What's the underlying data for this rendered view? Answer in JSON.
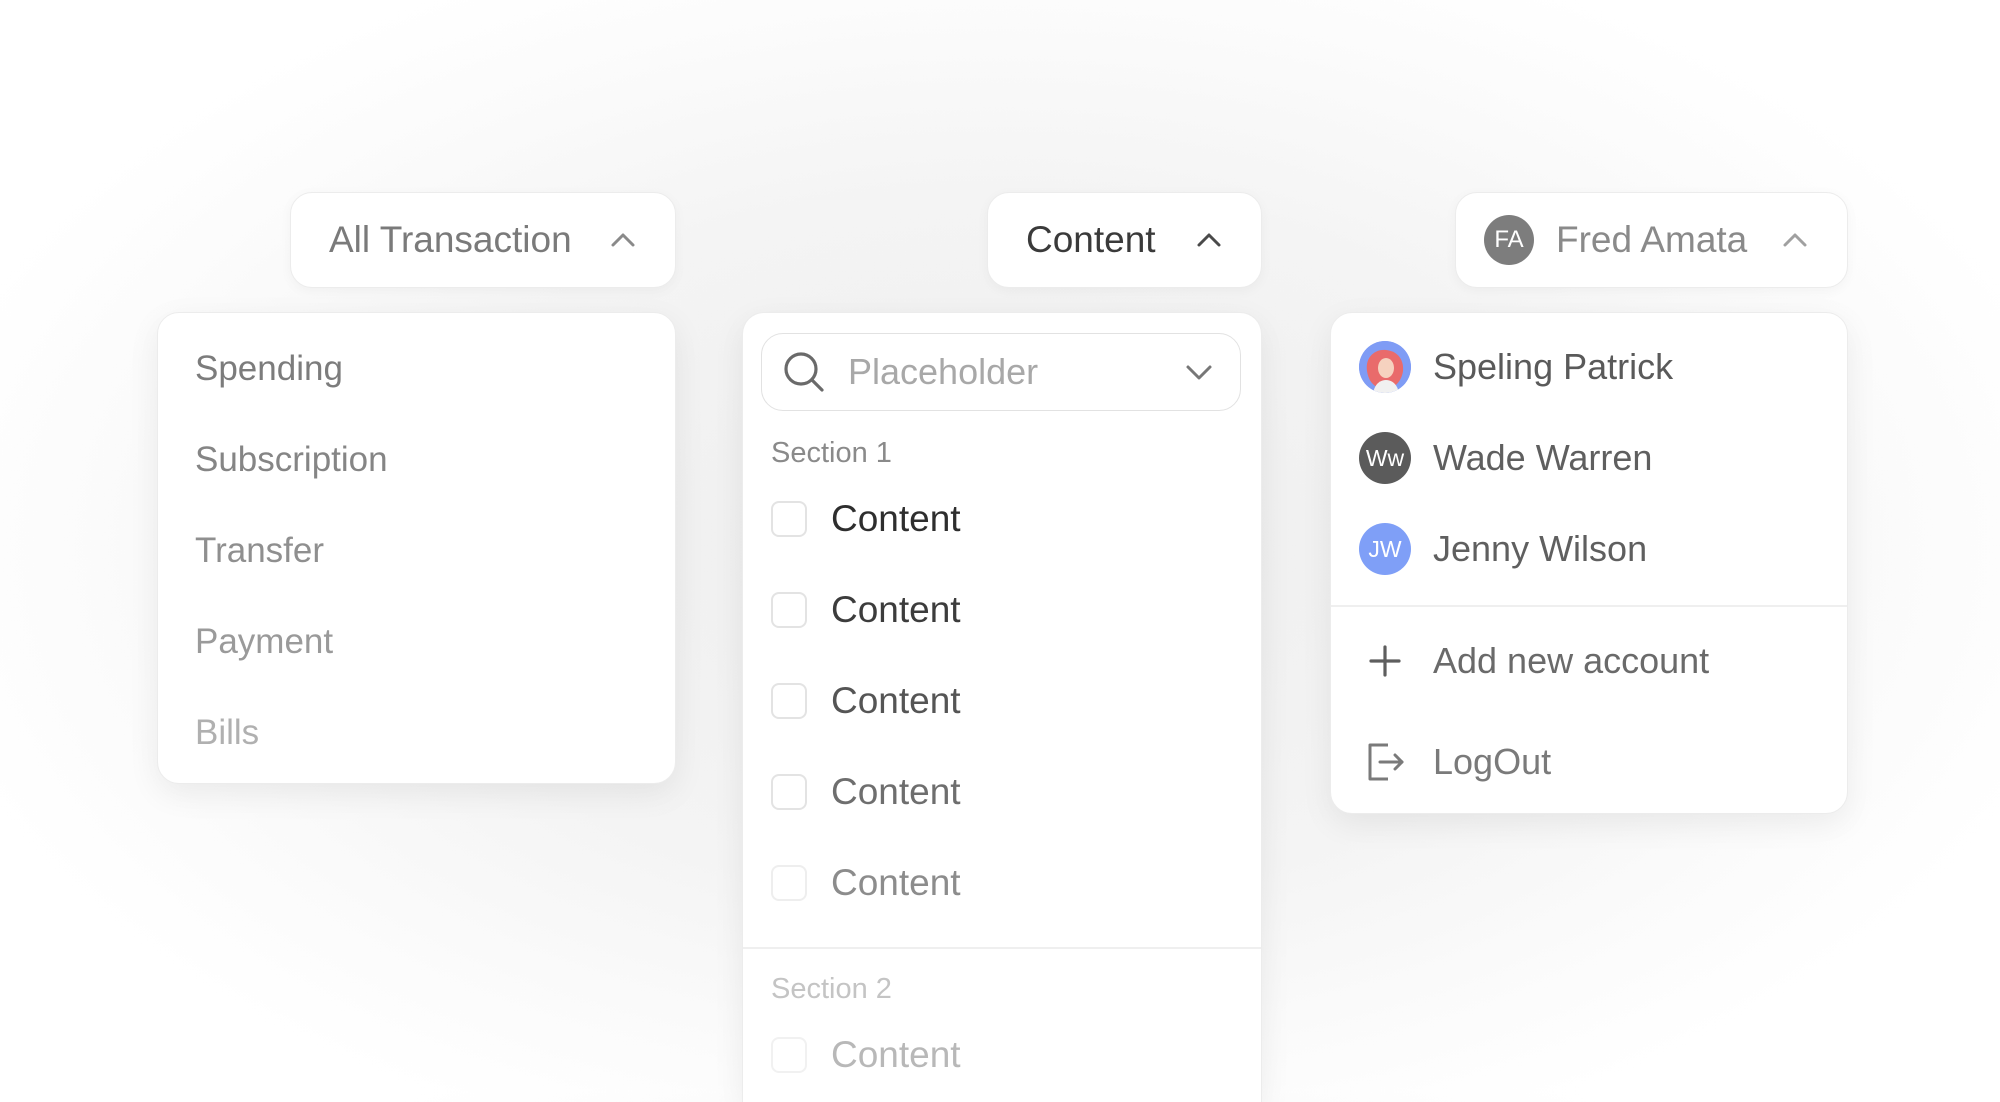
{
  "transactions": {
    "trigger_label": "All Transaction",
    "items": [
      {
        "label": "Spending",
        "color": "#7c7c7c"
      },
      {
        "label": "Subscription",
        "color": "#858585"
      },
      {
        "label": "Transfer",
        "color": "#8f8f8f"
      },
      {
        "label": "Payment",
        "color": "#9a9a9a"
      },
      {
        "label": "Bills",
        "color": "#b0b0b0"
      }
    ]
  },
  "content_dropdown": {
    "trigger_label": "Content",
    "search_placeholder": "Placeholder",
    "sections": [
      {
        "title": "Section 1",
        "title_color": "#8a8a8a",
        "items": [
          {
            "label": "Content",
            "checked": false,
            "color": "#2e2e2e"
          },
          {
            "label": "Content",
            "checked": false,
            "color": "#3c3c3c"
          },
          {
            "label": "Content",
            "checked": false,
            "color": "#555555"
          },
          {
            "label": "Content",
            "checked": false,
            "color": "#6e6e6e"
          },
          {
            "label": "Content",
            "checked": false,
            "color": "#8c8c8c"
          }
        ]
      },
      {
        "title": "Section 2",
        "title_color": "#c4c4c4",
        "items": [
          {
            "label": "Content",
            "checked": false,
            "color": "#b8b8b8"
          }
        ]
      }
    ]
  },
  "account": {
    "trigger_initials": "FA",
    "trigger_name": "Fred Amata",
    "trigger_avatar_color": "#7d7d7d",
    "users": [
      {
        "name": "Speling Patrick",
        "avatar": "photo",
        "avatar_color": "#7f9cf5",
        "color": "#5a5a5a"
      },
      {
        "name": "Wade Warren",
        "initials": "Ww",
        "avatar_color": "#5b5b5b",
        "color": "#5f5f5f"
      },
      {
        "name": "Jenny Wilson",
        "initials": "JW",
        "avatar_color": "#7f9ff7",
        "color": "#5f5f5f"
      }
    ],
    "actions": {
      "add_label": "Add new account",
      "logout_label": "LogOut"
    }
  }
}
